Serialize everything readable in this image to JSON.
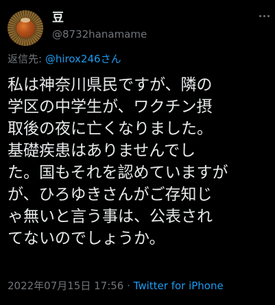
{
  "tweet": {
    "author": {
      "display_name": "豆",
      "handle": "@8732hanamame",
      "avatar_icon": "chestnut-avatar-icon"
    },
    "more_icon": "more-dots-icon",
    "reply_prefix": "返信先: ",
    "reply_to": "@hirox246さん",
    "body_lines": [
      "私は神奈川県民ですが、隣の",
      "学区の中学生が、ワクチン摂",
      "取後の夜に亡くなりました。",
      "基礎疾患はありませんでし",
      "た。国もそれを認めていますが",
      "が、ひろゆきさんがご存知じ",
      "ゃ無いと言う事は、公表され",
      "てないのでしょうか。"
    ],
    "timestamp": "2022年07月15日 17:56",
    "separator": " · ",
    "source": "Twitter for iPhone"
  },
  "colors": {
    "background": "#000000",
    "text_primary": "#e7e9ea",
    "text_secondary": "#71767b",
    "link": "#1d9bf0"
  }
}
